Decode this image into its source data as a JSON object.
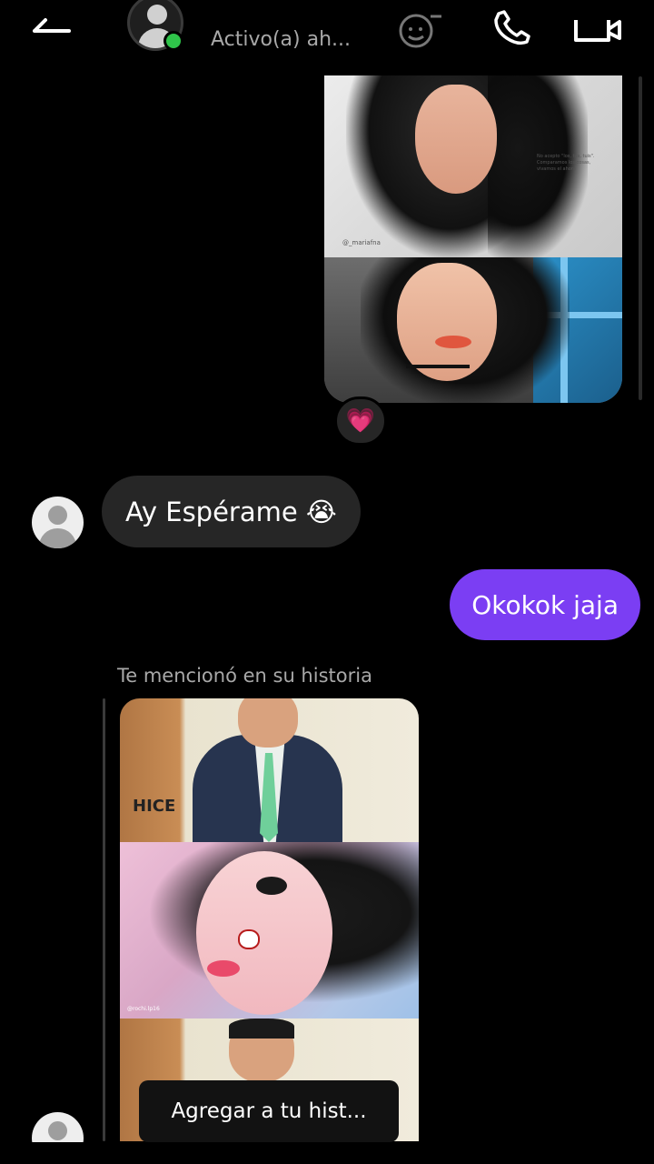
{
  "header": {
    "status": "Activo(a) ah...",
    "icons": [
      "back-arrow-icon",
      "profile-avatar",
      "sticker-icon",
      "phone-icon",
      "video-icon"
    ]
  },
  "messages": {
    "sent_image": {
      "reaction": "💗",
      "caption_tag": "@_mariafna",
      "quote": "No acepto \"los, tus, tuis\". Comparamos los cosas, vivamos el ahora"
    },
    "received_text": "Ay Espérame 😭",
    "sent_text": "Okokok jaja",
    "story_mention": {
      "label": "Te mencionó en su historia",
      "word": "HICE",
      "tag": "@rochi.lp16",
      "button": "Agregar a tu hist..."
    }
  },
  "colors": {
    "background": "#000000",
    "received_bubble": "#262626",
    "sent_bubble": "#7b3ef3",
    "online": "#2fc44a",
    "secondary_text": "#a8a8a8"
  }
}
